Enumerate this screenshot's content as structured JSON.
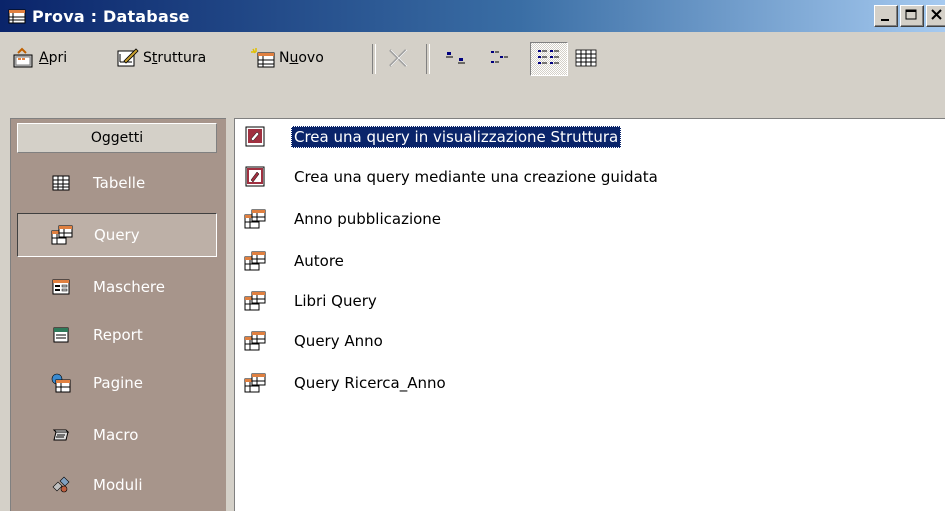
{
  "window": {
    "title": "Prova : Database"
  },
  "toolbar": {
    "open_label": "pri",
    "open_access": "A",
    "design_label_pre": "S",
    "design_access": "t",
    "design_label_post": "ruttura",
    "new_label_pre": "N",
    "new_access": "u",
    "new_label_post": "ovo"
  },
  "objects": {
    "header": "Oggetti",
    "items": [
      {
        "label": "Tabelle",
        "icon": "table-icon"
      },
      {
        "label": "Query",
        "icon": "query-icon"
      },
      {
        "label": "Maschere",
        "icon": "form-icon"
      },
      {
        "label": "Report",
        "icon": "report-icon"
      },
      {
        "label": "Pagine",
        "icon": "page-icon"
      },
      {
        "label": "Macro",
        "icon": "macro-icon"
      },
      {
        "label": "Moduli",
        "icon": "module-icon"
      }
    ],
    "selected": "Query"
  },
  "list": {
    "items": [
      {
        "label": "Crea una query in visualizzazione Struttura",
        "icon": "wizard-design-icon"
      },
      {
        "label": "Crea una query mediante una creazione guidata",
        "icon": "wizard-icon"
      },
      {
        "label": "Anno pubblicazione",
        "icon": "query-icon"
      },
      {
        "label": "Autore",
        "icon": "query-icon"
      },
      {
        "label": "Libri Query",
        "icon": "query-icon"
      },
      {
        "label": "Query Anno",
        "icon": "query-icon"
      },
      {
        "label": "Query Ricerca_Anno",
        "icon": "query-icon"
      }
    ],
    "selected_index": 0
  }
}
